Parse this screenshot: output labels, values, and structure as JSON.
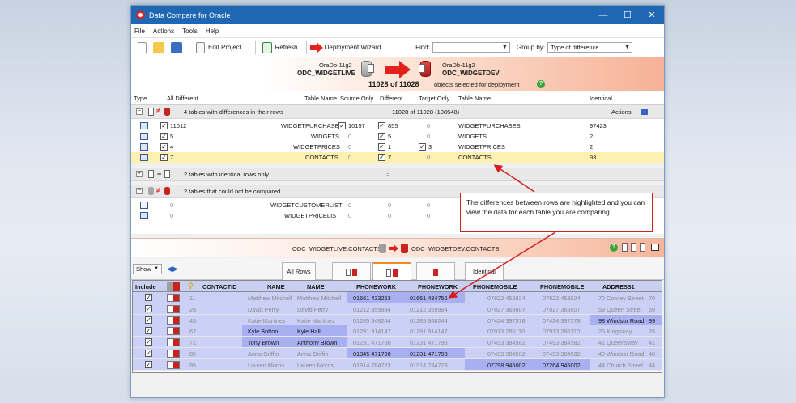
{
  "window": {
    "title": "Data Compare for Oracle"
  },
  "menu": [
    "File",
    "Actions",
    "Tools",
    "Help"
  ],
  "toolbar": {
    "edit_project": "Edit Project...",
    "refresh": "Refresh",
    "deployment_wizard": "Deployment Wizard...",
    "find_label": "Find:",
    "find_value": "",
    "group_by_label": "Group by:",
    "group_by_value": "Type of difference"
  },
  "banner": {
    "source_server": "OraDb-11g2",
    "source_schema": "ODC_WIDGETLIVE",
    "target_server": "OraDb-11g2",
    "target_schema": "ODC_WIDGETDEV",
    "selected_count": "11028 of 11028",
    "selected_text": "objects selected for deployment"
  },
  "grid": {
    "headers": {
      "type": "Type",
      "all_different": "All Different",
      "table_name": "Table Name",
      "source_only": "Source Only",
      "different": "Different",
      "target_only": "Target Only",
      "table_name2": "Table Name",
      "identical": "Identical"
    },
    "group1": {
      "label": "4 tables with differences in their rows",
      "summary": "11028 of 11028 (108548)",
      "actions": "Actions"
    },
    "rows1": [
      {
        "all": "11012",
        "name": "WIDGETPURCHASES",
        "source": "10157",
        "different": "855",
        "target": "0",
        "name2": "WIDGETPURCHASES",
        "identical": "97423"
      },
      {
        "all": "5",
        "name": "WIDGETS",
        "source": "0",
        "different": "5",
        "target": "0",
        "name2": "WIDGETS",
        "identical": "2"
      },
      {
        "all": "4",
        "name": "WIDGETPRICES",
        "source": "0",
        "different": "1",
        "target": "3",
        "name2": "WIDGETPRICES",
        "identical": "2"
      },
      {
        "all": "7",
        "name": "CONTACTS",
        "source": "0",
        "different": "7",
        "target": "0",
        "name2": "CONTACTS",
        "identical": "93"
      }
    ],
    "group2": {
      "label": "2 tables with identical rows only",
      "equals": "="
    },
    "group3": {
      "label": "2 tables that could not be compared"
    },
    "rows3": [
      {
        "all": "0",
        "name": "WIDGETCUSTOMERLIST",
        "source": "0",
        "different": "0",
        "target": "0"
      },
      {
        "all": "0",
        "name": "WIDGETPRICELIST",
        "source": "0",
        "different": "0",
        "target": "0"
      }
    ]
  },
  "annotation": "The differences between rows are highlighted and you can view the data for each table you are comparing",
  "lower": {
    "source_table": "ODC_WIDGETLIVE.CONTACTS",
    "target_table": "ODC_WIDGETDEV.CONTACTS",
    "show_label": "Show",
    "tabs": [
      "All Rows",
      "Identical"
    ]
  },
  "bottom_table": {
    "headers": [
      "Include",
      "CONTACTID",
      "NAME",
      "NAME",
      "PHONEWORK",
      "PHONEWORK",
      "PHONEMOBILE",
      "PHONEMOBILE",
      "ADDRESS1"
    ],
    "rows": [
      {
        "id": "11",
        "name_s": "Matthew Mitchell",
        "name_t": "Matthew Mitchell",
        "pw_s": "01661 433253",
        "pw_t": "01661 434756",
        "pm_s": "07822 453924",
        "pm_t": "07822 453924",
        "addr": "70 Cowley Street",
        "addr_t": "70"
      },
      {
        "id": "26",
        "name_s": "David Perry",
        "name_t": "David Perry",
        "pw_s": "01212 359994",
        "pw_t": "01212 359994",
        "pm_s": "07827 368607",
        "pm_t": "07827 368607",
        "addr": "59 Queen Street",
        "addr_t": "59"
      },
      {
        "id": "45",
        "name_s": "Katie Martinez",
        "name_t": "Katie Martinez",
        "pw_s": "01285 948244",
        "pw_t": "01285 948244",
        "pm_s": "07424 397578",
        "pm_t": "07424 397578",
        "addr": "98 Windsor Road",
        "addr_t": "99"
      },
      {
        "id": "67",
        "name_s": "Kyle Botton",
        "name_t": "Kyle Hall",
        "pw_s": "01291 914147",
        "pw_t": "01291 914147",
        "pm_s": "07913 286110",
        "pm_t": "07913 286110",
        "addr": "25 Kingsway",
        "addr_t": "25"
      },
      {
        "id": "71",
        "name_s": "Tony Brown",
        "name_t": "Anthony Brown",
        "pw_s": "01231 471798",
        "pw_t": "01231 471798",
        "pm_s": "07493 384582",
        "pm_t": "07493 384582",
        "addr": "41 Queensway",
        "addr_t": "41"
      },
      {
        "id": "85",
        "name_s": "Anna Griffin",
        "name_t": "Anna Griffin",
        "pw_s": "01345 471798",
        "pw_t": "01231 471798",
        "pm_s": "07493 384582",
        "pm_t": "07493 384582",
        "addr": "40 Windsor Road",
        "addr_t": "40"
      },
      {
        "id": "95",
        "name_s": "Lauren Morris",
        "name_t": "Lauren Morris",
        "pw_s": "01914 784723",
        "pw_t": "01914 784723",
        "pm_s": "07798 945002",
        "pm_t": "07264 945002",
        "addr": "44 Church Street",
        "addr_t": "44"
      }
    ]
  },
  "colors": {
    "title_bar": "#1f66b5",
    "arrow": "#e3221c",
    "annotation_border": "#d21f1f",
    "highlight_row": "#fdf0b0",
    "diff_cell": "#a9b0f2"
  }
}
